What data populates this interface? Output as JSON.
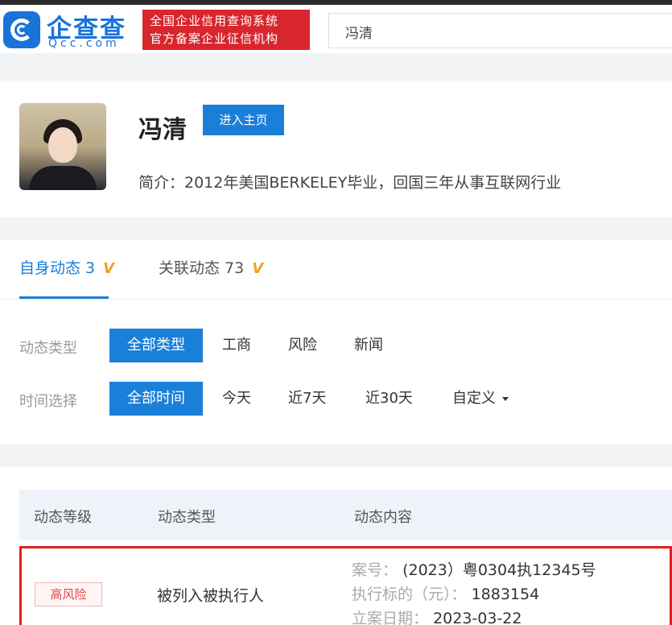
{
  "header": {
    "logo_cn": "企查查",
    "logo_en": "Qcc.com",
    "banner_line1": "全国企业信用查询系统",
    "banner_line2": "官方备案企业征信机构",
    "search_value": "冯清"
  },
  "profile": {
    "name": "冯清",
    "home_button": "进入主页",
    "intro": "简介：2012年美国BERKELEY毕业，回国三年从事互联网行业"
  },
  "tabs": [
    {
      "label": "自身动态 3"
    },
    {
      "label": "关联动态 73"
    }
  ],
  "vip_mark": "V",
  "filters": {
    "type_label": "动态类型",
    "type_options": [
      "全部类型",
      "工商",
      "风险",
      "新闻"
    ],
    "time_label": "时间选择",
    "time_options": [
      "全部时间",
      "今天",
      "近7天",
      "近30天",
      "自定义"
    ]
  },
  "table": {
    "headers": [
      "动态等级",
      "动态类型",
      "动态内容"
    ],
    "row": {
      "level": "高风险",
      "type": "被列入被执行人",
      "case_no_key": "案号：",
      "case_no_value": "(2023）粤0304执12345号",
      "amount_key": "执行标的（元）：",
      "amount_value": "1883154",
      "date_key": "立案日期：",
      "date_value": "2023-03-22"
    }
  }
}
